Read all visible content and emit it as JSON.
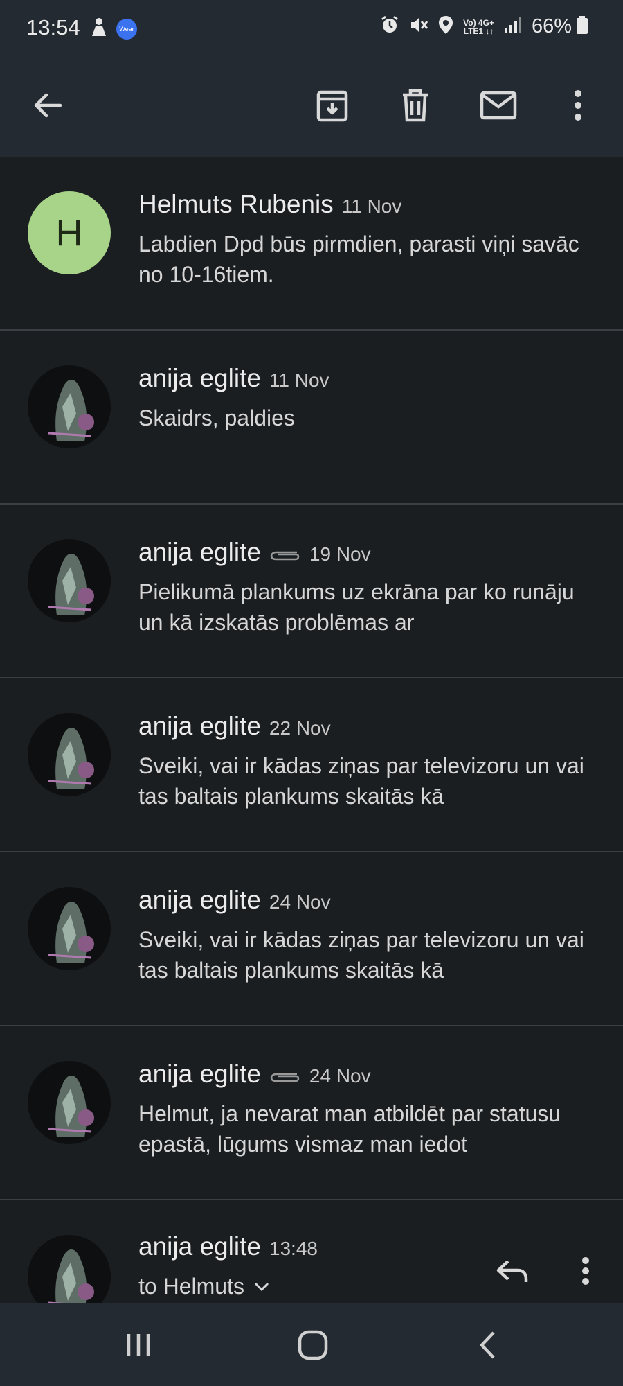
{
  "status_bar": {
    "time": "13:54",
    "wear_label": "Wear",
    "net_top": "Vo) 4G+",
    "net_bottom": "LTE1 ↓↑",
    "battery": "66%",
    "icons": [
      "person-icon",
      "wear-icon",
      "alarm-icon",
      "mute-icon",
      "location-icon",
      "signal-icon",
      "battery-icon"
    ]
  },
  "toolbar": {
    "icons": [
      "back-arrow-icon",
      "archive-icon",
      "trash-icon",
      "mail-icon",
      "more-vert-icon"
    ]
  },
  "messages": [
    {
      "sender": "Helmuts Rubenis",
      "date": "11 Nov",
      "attachment": false,
      "avatar_letter": "H",
      "snippet": "Labdien Dpd būs pirmdien, parasti viņi savāc no 10-16tiem."
    },
    {
      "sender": "anija eglite",
      "date": "11 Nov",
      "attachment": false,
      "snippet": "Skaidrs, paldies"
    },
    {
      "sender": "anija eglite",
      "date": "19 Nov",
      "attachment": true,
      "snippet": "Pielikumā plankums uz ekrāna par ko runāju un kā izskatās problēmas ar"
    },
    {
      "sender": "anija eglite",
      "date": "22 Nov",
      "attachment": false,
      "snippet": "Sveiki, vai ir kādas ziņas par televizoru un vai tas baltais plankums skaitās kā"
    },
    {
      "sender": "anija eglite",
      "date": "24 Nov",
      "attachment": false,
      "snippet": "Sveiki, vai ir kādas ziņas par televizoru un vai tas baltais plankums skaitās kā"
    },
    {
      "sender": "anija eglite",
      "date": "24 Nov",
      "attachment": true,
      "snippet": "Helmut, ja nevarat man atbildēt par statusu epastā, lūgums vismaz man iedot"
    }
  ],
  "expanded_message": {
    "sender": "anija eglite",
    "time": "13:48",
    "recipient_line": "to Helmuts"
  },
  "colors": {
    "background": "#1b1e21",
    "bars": "#232a31",
    "divider": "#3b3f44",
    "avatar_h": "#a8d48a"
  }
}
